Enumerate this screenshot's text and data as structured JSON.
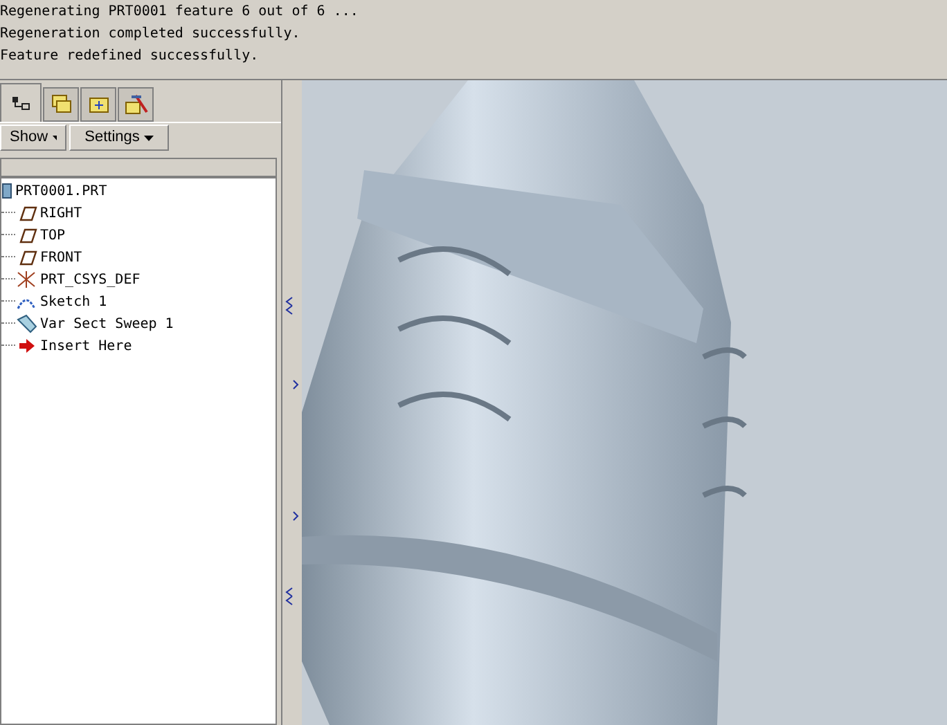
{
  "messages": [
    "Regenerating PRT0001 feature 6 out of 6 ...",
    "Regeneration completed successfully.",
    "Feature redefined successfully."
  ],
  "tabs": [
    {
      "kind": "tree",
      "selected": true
    },
    {
      "kind": "layers",
      "selected": false
    },
    {
      "kind": "folder",
      "selected": false
    },
    {
      "kind": "tools",
      "selected": false
    }
  ],
  "toolbar": [
    "Show",
    "Settings"
  ],
  "model_tree": {
    "label": "PRT0001.PRT",
    "kind": "part",
    "children": [
      {
        "label": "RIGHT",
        "kind": "plane"
      },
      {
        "label": "TOP",
        "kind": "plane"
      },
      {
        "label": "FRONT",
        "kind": "plane"
      },
      {
        "label": "PRT_CSYS_DEF",
        "kind": "csys"
      },
      {
        "label": "Sketch 1",
        "kind": "sketch"
      },
      {
        "label": "Var Sect Sweep 1",
        "kind": "sweep"
      },
      {
        "label": "Insert Here",
        "kind": "insert"
      }
    ]
  }
}
